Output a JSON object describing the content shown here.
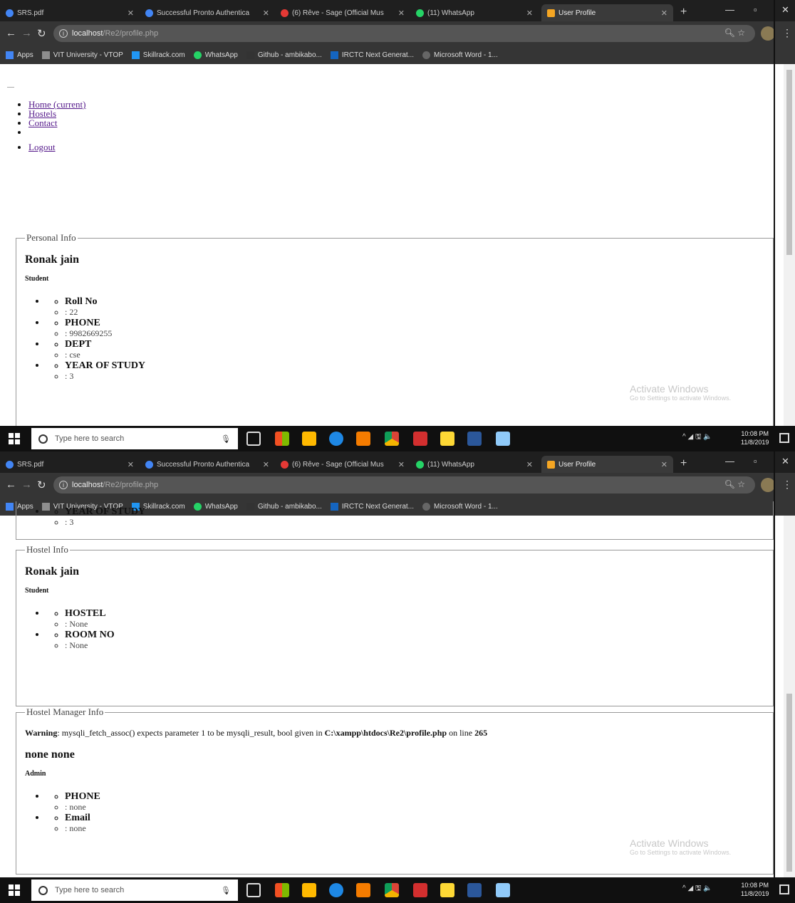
{
  "browser": {
    "tabs": [
      {
        "label": "SRS.pdf",
        "color": "#4285f4"
      },
      {
        "label": "Successful Pronto Authentica",
        "color": "#4285f4"
      },
      {
        "label": "(6) Rêve - Sage (Official Mus",
        "color": "#e53935"
      },
      {
        "label": "(11) WhatsApp",
        "color": "#25d366"
      },
      {
        "label": "User Profile",
        "color": "#f5a623"
      }
    ],
    "url_host": "localhost",
    "url_path": "/Re2/profile.php",
    "bookmarks": [
      {
        "label": "Apps",
        "color": "#4285f4"
      },
      {
        "label": "VIT University - VTOP",
        "color": "#8e8e8e"
      },
      {
        "label": "Skillrack.com",
        "color": "#2196f3"
      },
      {
        "label": "WhatsApp",
        "color": "#25d366"
      },
      {
        "label": "Github - ambikabo...",
        "color": "#333333"
      },
      {
        "label": "IRCTC Next Generat...",
        "color": "#1565c0"
      },
      {
        "label": "Microsoft Word - 1...",
        "color": "#666666"
      }
    ]
  },
  "nav": {
    "items": [
      "Home (current)",
      "Hostels",
      "Contact",
      "",
      "Logout"
    ]
  },
  "personal": {
    "legend": "Personal Info",
    "name": "Ronak jain",
    "role": "Student",
    "fields": [
      {
        "key": "Roll No",
        "value": ": 22"
      },
      {
        "key": "PHONE",
        "value": ": 9982669255"
      },
      {
        "key": "DEPT",
        "value": ": cse"
      },
      {
        "key": "YEAR OF STUDY",
        "value": ": 3"
      }
    ]
  },
  "hostel": {
    "legend": "Hostel Info",
    "name": "Ronak jain",
    "role": "Student",
    "fields": [
      {
        "key": "HOSTEL",
        "value": ": None"
      },
      {
        "key": "ROOM NO",
        "value": ": None"
      }
    ]
  },
  "manager": {
    "legend": "Hostel Manager Info",
    "warning_label": "Warning",
    "warning_text": ": mysqli_fetch_assoc() expects parameter 1 to be mysqli_result, bool given in ",
    "warning_path": "C:\\xampp\\htdocs\\Re2\\profile.php",
    "warning_suffix": " on line ",
    "warning_line": "265",
    "name": "none none",
    "role": "Admin",
    "fields": [
      {
        "key": "PHONE",
        "value": ": none"
      },
      {
        "key": "Email",
        "value": ": none"
      }
    ]
  },
  "watermark": {
    "line1": "Activate Windows",
    "line2": "Go to Settings to activate Windows."
  },
  "taskbar": {
    "search_placeholder": "Type here to search",
    "time": "10:08 PM",
    "date": "11/8/2019"
  }
}
